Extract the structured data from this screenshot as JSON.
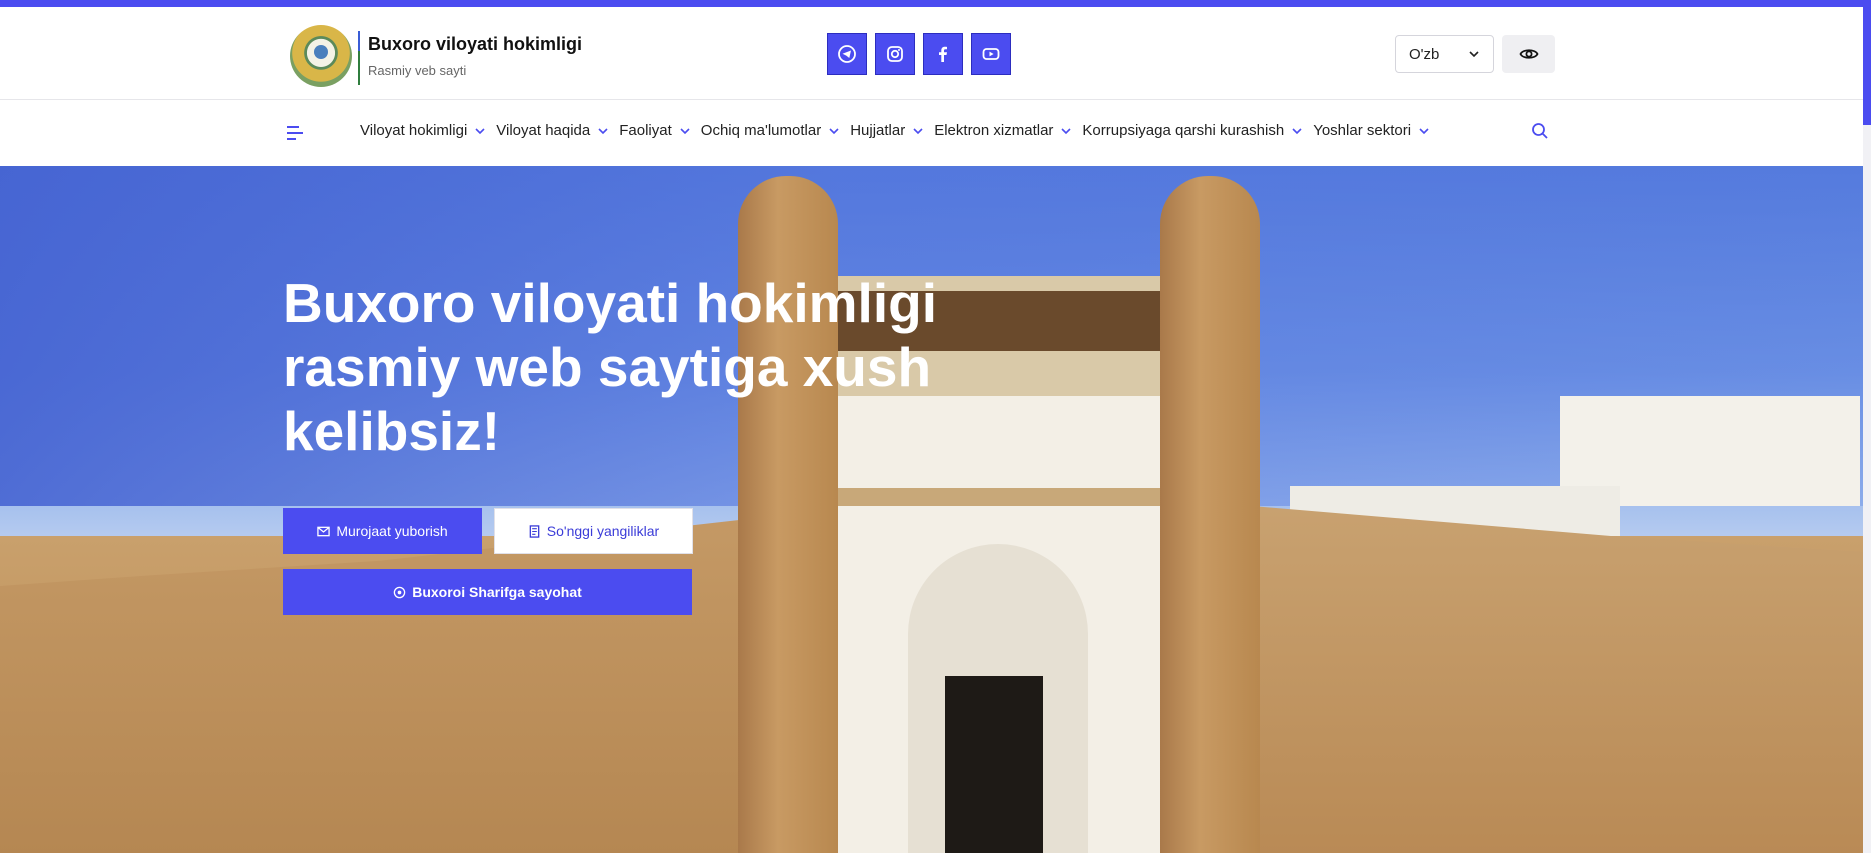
{
  "colors": {
    "accent": "#4b4cf0",
    "white": "#ffffff",
    "text": "#222222"
  },
  "header": {
    "title": "Buxoro viloyati hokimligi",
    "subtitle": "Rasmiy veb sayti",
    "socials": [
      {
        "icon": "telegram-icon"
      },
      {
        "icon": "instagram-icon"
      },
      {
        "icon": "facebook-icon"
      },
      {
        "icon": "youtube-icon"
      }
    ],
    "language": "O'zb",
    "accessibility_icon": "eye-icon"
  },
  "nav": {
    "items": [
      {
        "label": "Viloyat hokimligi"
      },
      {
        "label": "Viloyat haqida"
      },
      {
        "label": "Faoliyat"
      },
      {
        "label": "Ochiq ma'lumotlar"
      },
      {
        "label": "Hujjatlar"
      },
      {
        "label": "Elektron xizmatlar"
      },
      {
        "label": "Korrupsiyaga qarshi kurashish"
      },
      {
        "label": "Yoshlar sektori"
      }
    ]
  },
  "hero": {
    "title": "Buxoro viloyati hokimligi rasmiy web saytiga xush kelibsiz!",
    "buttons": {
      "appeal": "Murojaat yuborish",
      "news": "So'nggi yangiliklar",
      "tour": "Buxoroi Sharifga sayohat"
    }
  }
}
